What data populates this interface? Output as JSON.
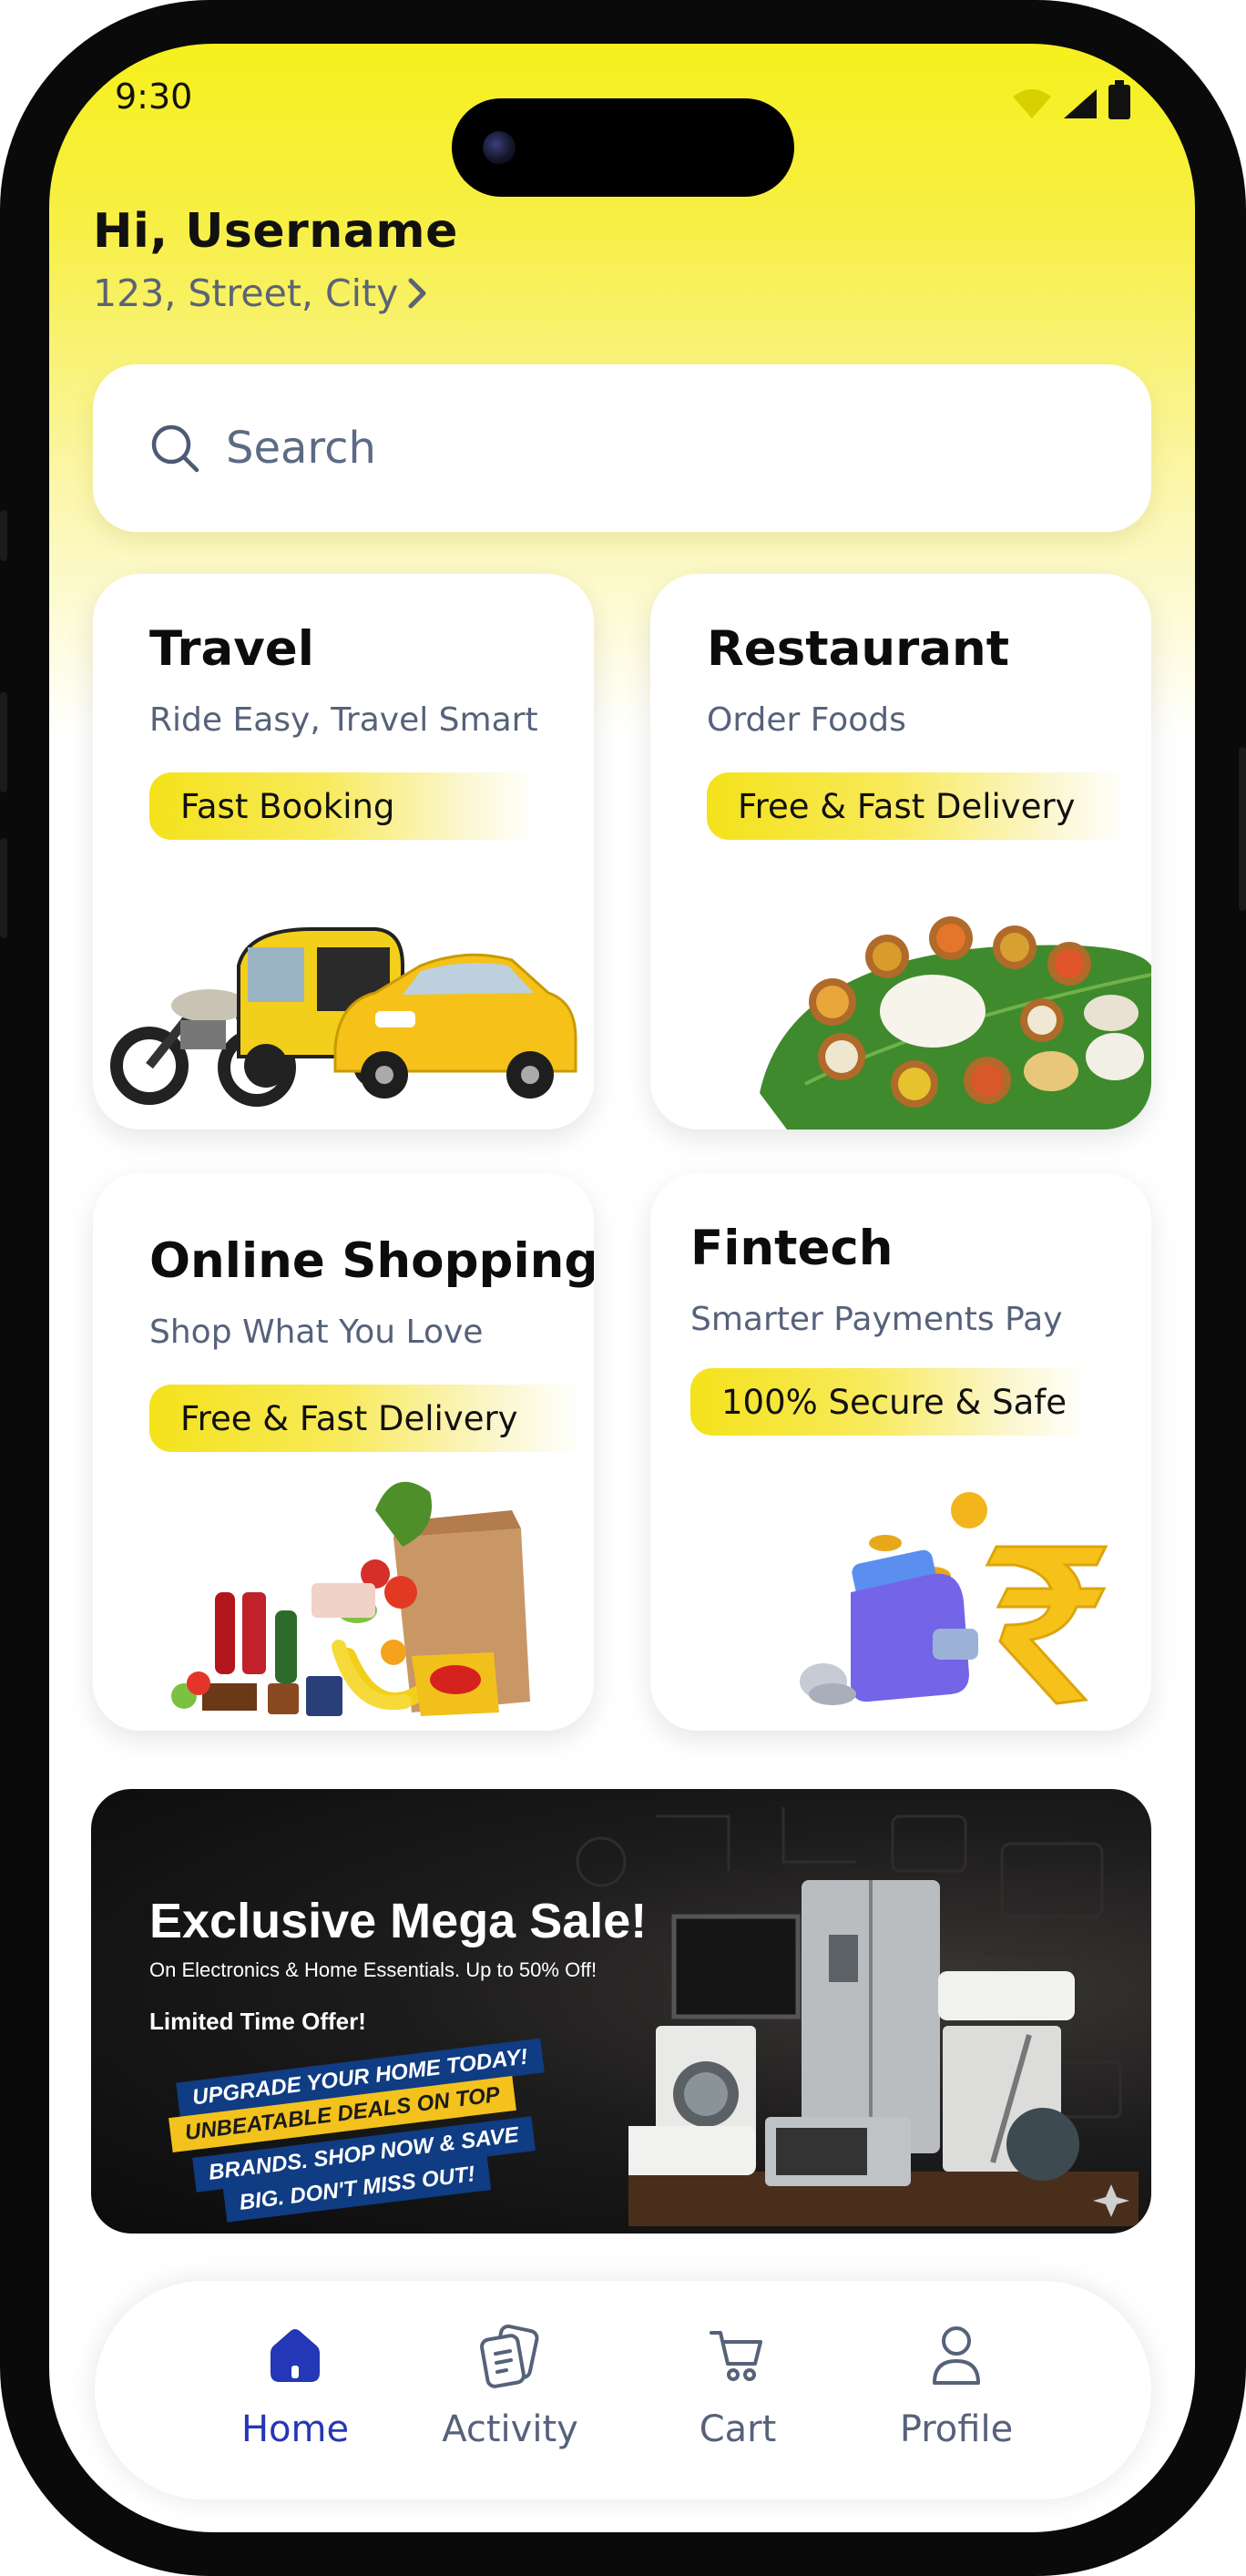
{
  "status_bar": {
    "time": "9:30"
  },
  "header": {
    "greeting": "Hi, Username",
    "address": "123, Street, City"
  },
  "search": {
    "placeholder": "Search"
  },
  "cards": [
    {
      "title": "Travel",
      "subtitle": "Ride Easy, Travel Smart",
      "badge": "Fast Booking"
    },
    {
      "title": "Restaurant",
      "subtitle": "Order Foods",
      "badge": "Free & Fast Delivery"
    },
    {
      "title": "Online Shopping",
      "subtitle": "Shop What You Love",
      "badge": "Free & Fast Delivery"
    },
    {
      "title": "Fintech",
      "subtitle": "Smarter Payments Pay",
      "badge": "100% Secure & Safe"
    }
  ],
  "banner": {
    "headline": "Exclusive Mega Sale!",
    "subline": "On Electronics & Home Essentials. Up to 50% Off!",
    "tagline": "Limited Time Offer!",
    "ribbon_lines": [
      "UPGRADE YOUR HOME TODAY!",
      "UNBEATABLE DEALS ON TOP",
      "BRANDS. SHOP NOW & SAVE",
      "BIG. DON'T MISS OUT!"
    ]
  },
  "nav": {
    "items": [
      {
        "label": "Home",
        "icon": "home-icon",
        "active": true
      },
      {
        "label": "Activity",
        "icon": "activity-icon",
        "active": false
      },
      {
        "label": "Cart",
        "icon": "cart-icon",
        "active": false
      },
      {
        "label": "Profile",
        "icon": "profile-icon",
        "active": false
      }
    ]
  },
  "colors": {
    "accent_yellow": "#f6f01d",
    "nav_active": "#2437b6",
    "muted_text": "#56627a"
  }
}
